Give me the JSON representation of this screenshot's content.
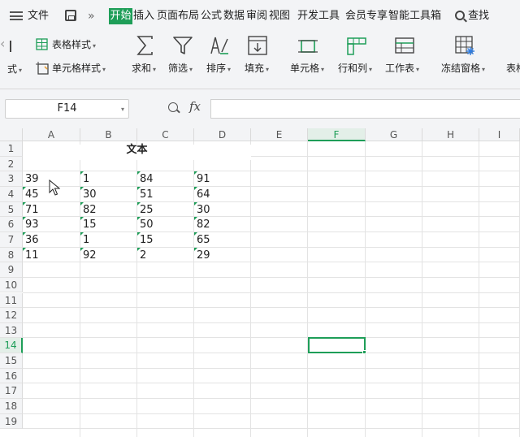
{
  "menubar": {
    "file_label": "文件",
    "more_label": "»",
    "tabs": [
      "开始",
      "插入",
      "页面布局",
      "公式",
      "数据",
      "审阅",
      "视图",
      "开发工具",
      "会员专享",
      "智能工具箱"
    ],
    "search_label": "查找"
  },
  "ribbon": {
    "partial_left_label": "式",
    "table_style_label": "表格样式",
    "cell_style_label": "单元格样式",
    "sum_label": "求和",
    "filter_label": "筛选",
    "sort_label": "排序",
    "fill_label": "填充",
    "cell_label": "单元格",
    "rowcol_label": "行和列",
    "worksheet_label": "工作表",
    "freeze_label": "冻结窗格",
    "partial_right_label": "表格"
  },
  "formula_bar": {
    "name_box": "F14",
    "fx_label": "fx",
    "formula_value": ""
  },
  "sheet": {
    "columns": [
      "A",
      "B",
      "C",
      "D",
      "E",
      "F",
      "G",
      "H",
      "I"
    ],
    "rows": [
      "1",
      "2",
      "3",
      "4",
      "5",
      "6",
      "7",
      "8",
      "9",
      "10",
      "11",
      "12",
      "13",
      "14",
      "15",
      "16",
      "17",
      "18",
      "19"
    ],
    "active_column": "F",
    "active_row": "14",
    "title": "文本",
    "data": [
      [
        "39",
        "1",
        "84",
        "91"
      ],
      [
        "45",
        "30",
        "51",
        "64"
      ],
      [
        "71",
        "82",
        "25",
        "30"
      ],
      [
        "93",
        "15",
        "50",
        "82"
      ],
      [
        "36",
        "1",
        "15",
        "65"
      ],
      [
        "11",
        "92",
        "2",
        "29"
      ]
    ]
  },
  "colors": {
    "accent": "#1e9e58",
    "toolbar_bg": "#f3f4f6"
  }
}
